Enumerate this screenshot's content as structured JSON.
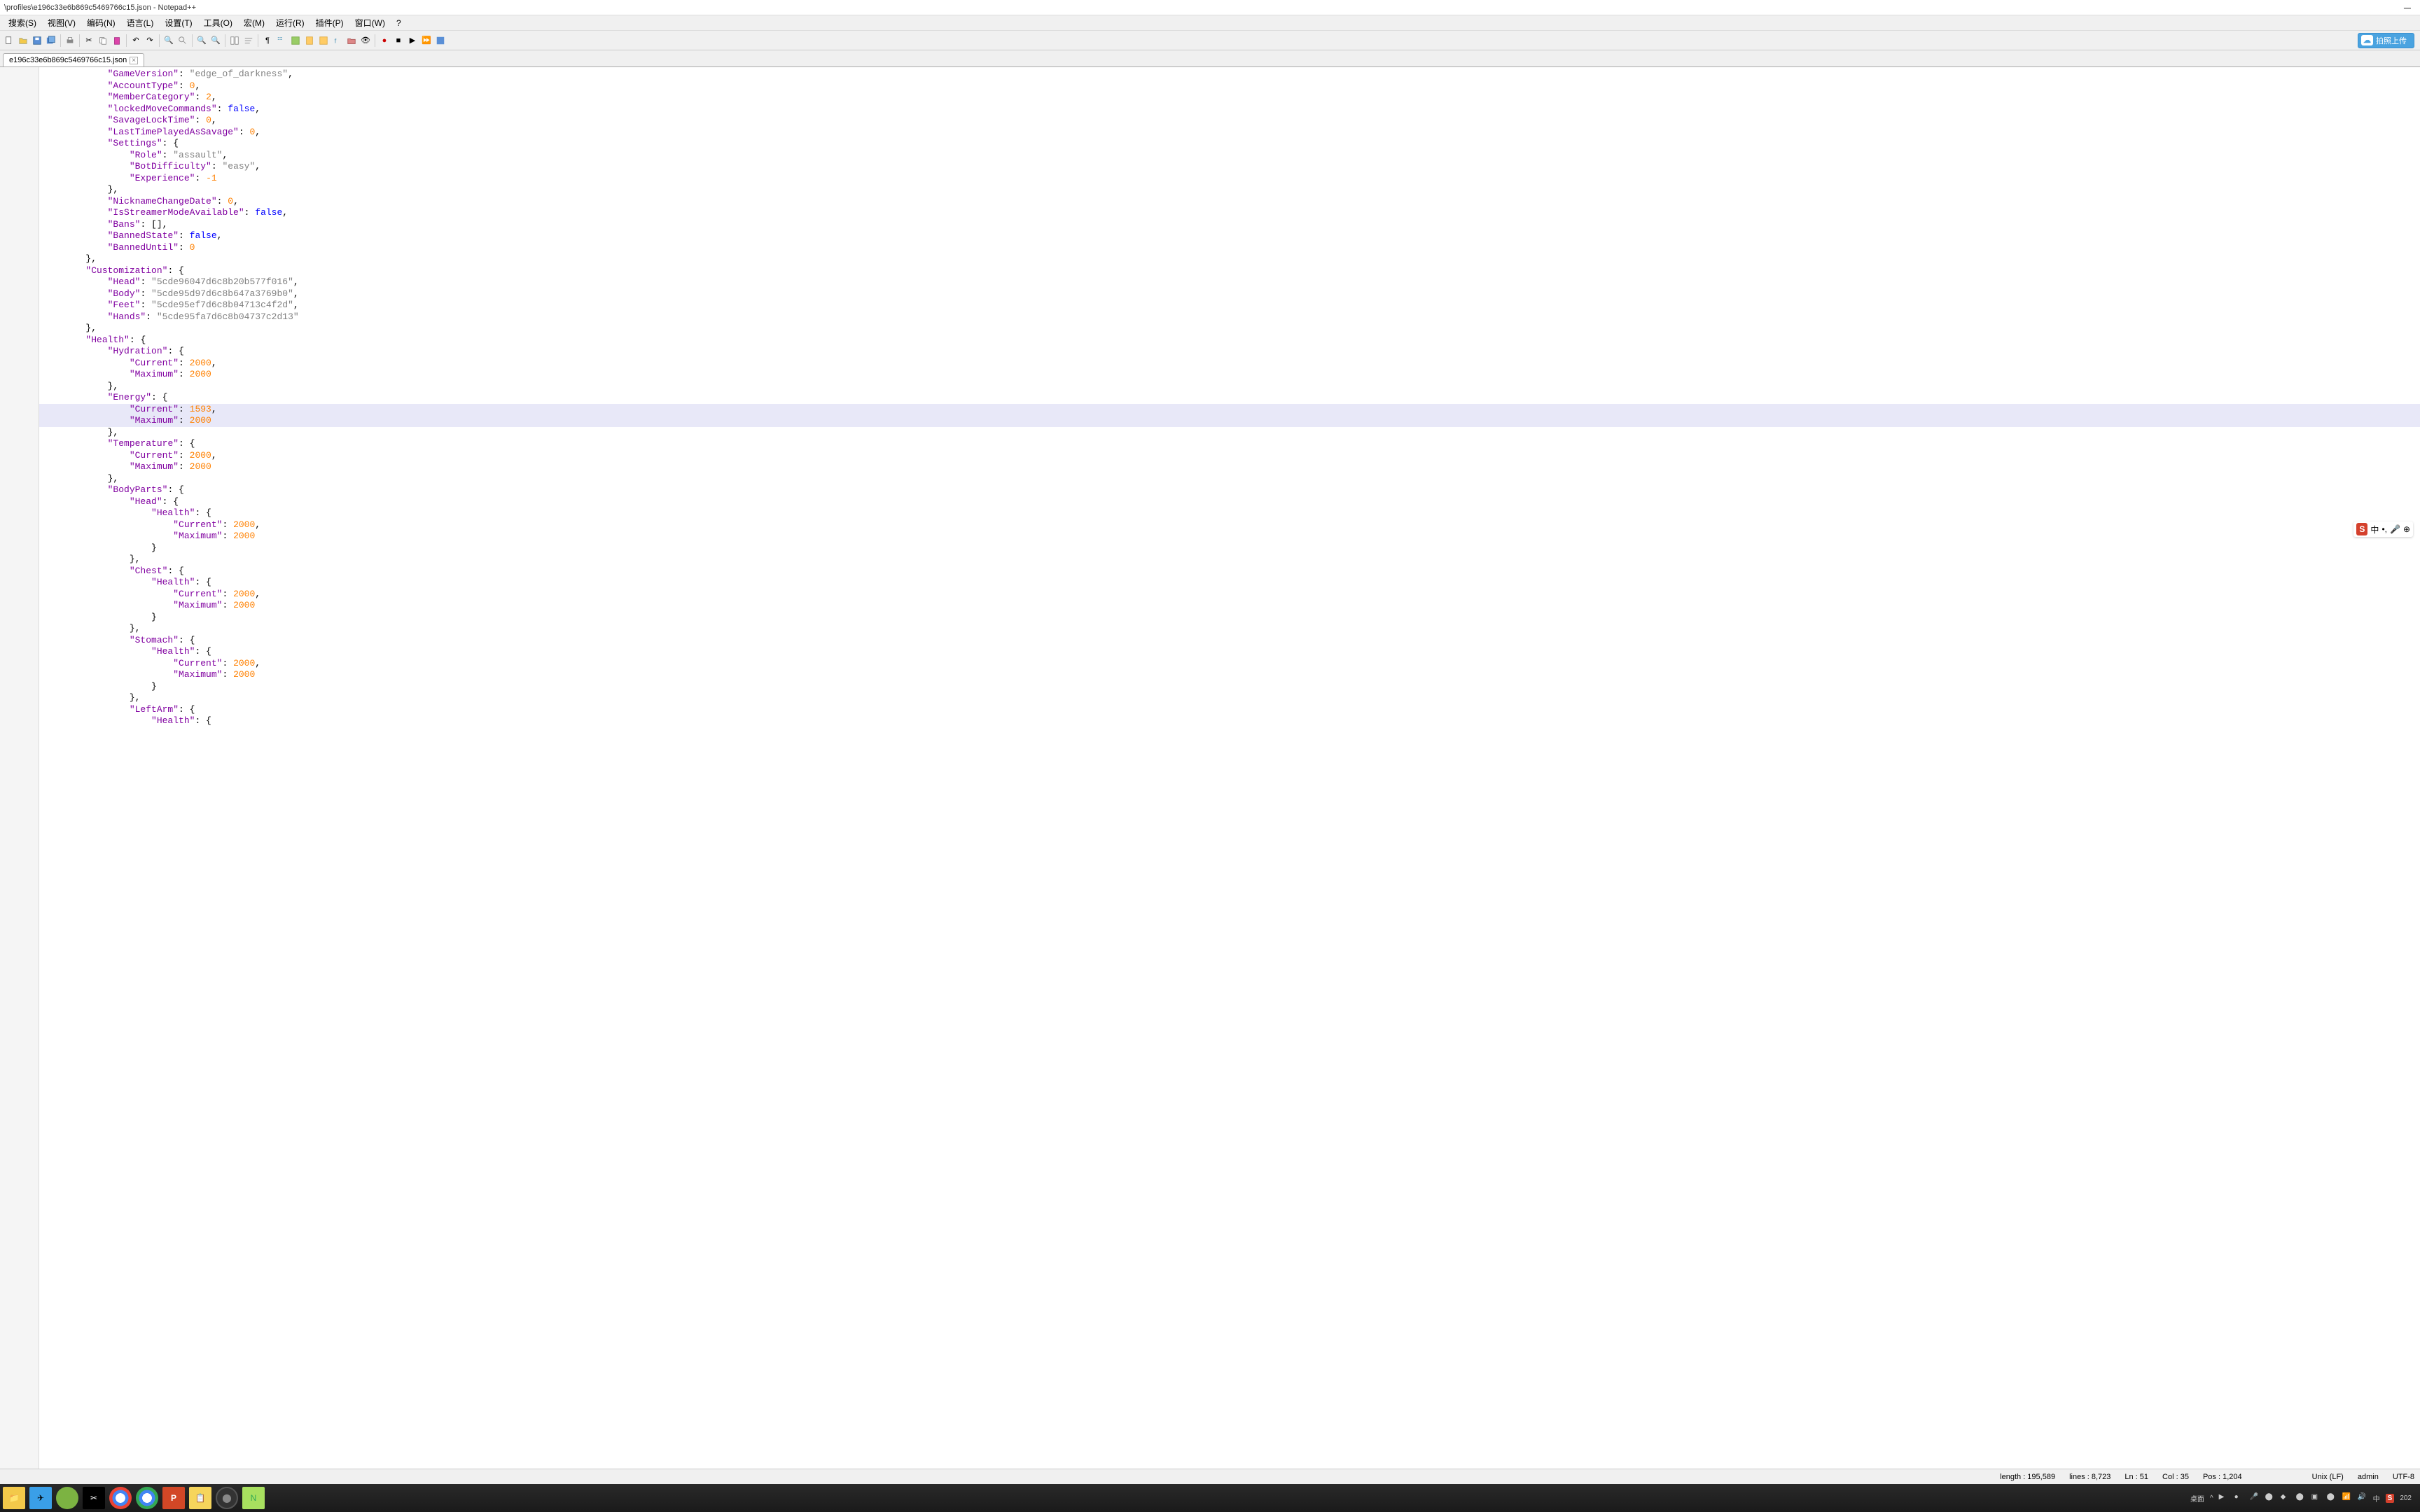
{
  "window": {
    "title": "\\profiles\\e196c33e6b869c5469766c15.json - Notepad++"
  },
  "menu": {
    "search": "搜索(S)",
    "view": "视图(V)",
    "encoding": "编码(N)",
    "language": "语言(L)",
    "settings": "设置(T)",
    "tools": "工具(O)",
    "macro": "宏(M)",
    "run": "运行(R)",
    "plugins": "插件(P)",
    "window": "窗口(W)",
    "help": "?"
  },
  "upload_button": "拍照上传",
  "tab": {
    "name": "e196c33e6b869c5469766c15.json"
  },
  "code": {
    "lines": [
      {
        "indent": 3,
        "content": [
          {
            "t": "key",
            "v": "\"GameVersion\""
          },
          {
            "t": "punc",
            "v": ": "
          },
          {
            "t": "str",
            "v": "\"edge_of_darkness\""
          },
          {
            "t": "punc",
            "v": ","
          }
        ]
      },
      {
        "indent": 3,
        "content": [
          {
            "t": "key",
            "v": "\"AccountType\""
          },
          {
            "t": "punc",
            "v": ": "
          },
          {
            "t": "num",
            "v": "0"
          },
          {
            "t": "punc",
            "v": ","
          }
        ]
      },
      {
        "indent": 3,
        "content": [
          {
            "t": "key",
            "v": "\"MemberCategory\""
          },
          {
            "t": "punc",
            "v": ": "
          },
          {
            "t": "num",
            "v": "2"
          },
          {
            "t": "punc",
            "v": ","
          }
        ]
      },
      {
        "indent": 3,
        "content": [
          {
            "t": "key",
            "v": "\"lockedMoveCommands\""
          },
          {
            "t": "punc",
            "v": ": "
          },
          {
            "t": "bool",
            "v": "false"
          },
          {
            "t": "punc",
            "v": ","
          }
        ]
      },
      {
        "indent": 3,
        "content": [
          {
            "t": "key",
            "v": "\"SavageLockTime\""
          },
          {
            "t": "punc",
            "v": ": "
          },
          {
            "t": "num",
            "v": "0"
          },
          {
            "t": "punc",
            "v": ","
          }
        ]
      },
      {
        "indent": 3,
        "content": [
          {
            "t": "key",
            "v": "\"LastTimePlayedAsSavage\""
          },
          {
            "t": "punc",
            "v": ": "
          },
          {
            "t": "num",
            "v": "0"
          },
          {
            "t": "punc",
            "v": ","
          }
        ]
      },
      {
        "indent": 3,
        "content": [
          {
            "t": "key",
            "v": "\"Settings\""
          },
          {
            "t": "punc",
            "v": ": {"
          }
        ]
      },
      {
        "indent": 4,
        "content": [
          {
            "t": "key",
            "v": "\"Role\""
          },
          {
            "t": "punc",
            "v": ": "
          },
          {
            "t": "str",
            "v": "\"assault\""
          },
          {
            "t": "punc",
            "v": ","
          }
        ]
      },
      {
        "indent": 4,
        "content": [
          {
            "t": "key",
            "v": "\"BotDifficulty\""
          },
          {
            "t": "punc",
            "v": ": "
          },
          {
            "t": "str",
            "v": "\"easy\""
          },
          {
            "t": "punc",
            "v": ","
          }
        ]
      },
      {
        "indent": 4,
        "content": [
          {
            "t": "key",
            "v": "\"Experience\""
          },
          {
            "t": "punc",
            "v": ": "
          },
          {
            "t": "num",
            "v": "-1"
          }
        ]
      },
      {
        "indent": 3,
        "content": [
          {
            "t": "punc",
            "v": "},"
          }
        ]
      },
      {
        "indent": 3,
        "content": [
          {
            "t": "key",
            "v": "\"NicknameChangeDate\""
          },
          {
            "t": "punc",
            "v": ": "
          },
          {
            "t": "num",
            "v": "0"
          },
          {
            "t": "punc",
            "v": ","
          }
        ]
      },
      {
        "indent": 3,
        "content": [
          {
            "t": "key",
            "v": "\"IsStreamerModeAvailable\""
          },
          {
            "t": "punc",
            "v": ": "
          },
          {
            "t": "bool",
            "v": "false"
          },
          {
            "t": "punc",
            "v": ","
          }
        ]
      },
      {
        "indent": 3,
        "content": [
          {
            "t": "key",
            "v": "\"Bans\""
          },
          {
            "t": "punc",
            "v": ": [],"
          }
        ]
      },
      {
        "indent": 3,
        "content": [
          {
            "t": "key",
            "v": "\"BannedState\""
          },
          {
            "t": "punc",
            "v": ": "
          },
          {
            "t": "bool",
            "v": "false"
          },
          {
            "t": "punc",
            "v": ","
          }
        ]
      },
      {
        "indent": 3,
        "content": [
          {
            "t": "key",
            "v": "\"BannedUntil\""
          },
          {
            "t": "punc",
            "v": ": "
          },
          {
            "t": "num",
            "v": "0"
          }
        ]
      },
      {
        "indent": 2,
        "content": [
          {
            "t": "punc",
            "v": "},"
          }
        ]
      },
      {
        "indent": 2,
        "content": [
          {
            "t": "key",
            "v": "\"Customization\""
          },
          {
            "t": "punc",
            "v": ": {"
          }
        ]
      },
      {
        "indent": 3,
        "content": [
          {
            "t": "key",
            "v": "\"Head\""
          },
          {
            "t": "punc",
            "v": ": "
          },
          {
            "t": "str",
            "v": "\"5cde96047d6c8b20b577f016\""
          },
          {
            "t": "punc",
            "v": ","
          }
        ]
      },
      {
        "indent": 3,
        "content": [
          {
            "t": "key",
            "v": "\"Body\""
          },
          {
            "t": "punc",
            "v": ": "
          },
          {
            "t": "str",
            "v": "\"5cde95d97d6c8b647a3769b0\""
          },
          {
            "t": "punc",
            "v": ","
          }
        ]
      },
      {
        "indent": 3,
        "content": [
          {
            "t": "key",
            "v": "\"Feet\""
          },
          {
            "t": "punc",
            "v": ": "
          },
          {
            "t": "str",
            "v": "\"5cde95ef7d6c8b04713c4f2d\""
          },
          {
            "t": "punc",
            "v": ","
          }
        ]
      },
      {
        "indent": 3,
        "content": [
          {
            "t": "key",
            "v": "\"Hands\""
          },
          {
            "t": "punc",
            "v": ": "
          },
          {
            "t": "str",
            "v": "\"5cde95fa7d6c8b04737c2d13\""
          }
        ]
      },
      {
        "indent": 2,
        "content": [
          {
            "t": "punc",
            "v": "},"
          }
        ]
      },
      {
        "indent": 2,
        "content": [
          {
            "t": "key",
            "v": "\"Health\""
          },
          {
            "t": "punc",
            "v": ": {"
          }
        ]
      },
      {
        "indent": 3,
        "content": [
          {
            "t": "key",
            "v": "\"Hydration\""
          },
          {
            "t": "punc",
            "v": ": {"
          }
        ]
      },
      {
        "indent": 4,
        "content": [
          {
            "t": "key",
            "v": "\"Current\""
          },
          {
            "t": "punc",
            "v": ": "
          },
          {
            "t": "num",
            "v": "2000"
          },
          {
            "t": "punc",
            "v": ","
          }
        ]
      },
      {
        "indent": 4,
        "content": [
          {
            "t": "key",
            "v": "\"Maximum\""
          },
          {
            "t": "punc",
            "v": ": "
          },
          {
            "t": "num",
            "v": "2000"
          }
        ]
      },
      {
        "indent": 3,
        "content": [
          {
            "t": "punc",
            "v": "},"
          }
        ]
      },
      {
        "indent": 3,
        "content": [
          {
            "t": "key",
            "v": "\"Energy\""
          },
          {
            "t": "punc",
            "v": ": {"
          }
        ]
      },
      {
        "indent": 4,
        "hl": true,
        "content": [
          {
            "t": "key",
            "v": "\"Current\""
          },
          {
            "t": "punc",
            "v": ": "
          },
          {
            "t": "num",
            "v": "1593"
          },
          {
            "t": "punc",
            "v": ","
          }
        ]
      },
      {
        "indent": 4,
        "hl": true,
        "content": [
          {
            "t": "key",
            "v": "\"Maximum\""
          },
          {
            "t": "punc",
            "v": ": "
          },
          {
            "t": "num",
            "v": "2000"
          }
        ]
      },
      {
        "indent": 3,
        "content": [
          {
            "t": "punc",
            "v": "},"
          }
        ]
      },
      {
        "indent": 3,
        "content": [
          {
            "t": "key",
            "v": "\"Temperature\""
          },
          {
            "t": "punc",
            "v": ": {"
          }
        ]
      },
      {
        "indent": 4,
        "content": [
          {
            "t": "key",
            "v": "\"Current\""
          },
          {
            "t": "punc",
            "v": ": "
          },
          {
            "t": "num",
            "v": "2000"
          },
          {
            "t": "punc",
            "v": ","
          }
        ]
      },
      {
        "indent": 4,
        "content": [
          {
            "t": "key",
            "v": "\"Maximum\""
          },
          {
            "t": "punc",
            "v": ": "
          },
          {
            "t": "num",
            "v": "2000"
          }
        ]
      },
      {
        "indent": 3,
        "content": [
          {
            "t": "punc",
            "v": "},"
          }
        ]
      },
      {
        "indent": 3,
        "content": [
          {
            "t": "key",
            "v": "\"BodyParts\""
          },
          {
            "t": "punc",
            "v": ": {"
          }
        ]
      },
      {
        "indent": 4,
        "content": [
          {
            "t": "key",
            "v": "\"Head\""
          },
          {
            "t": "punc",
            "v": ": {"
          }
        ]
      },
      {
        "indent": 5,
        "content": [
          {
            "t": "key",
            "v": "\"Health\""
          },
          {
            "t": "punc",
            "v": ": {"
          }
        ]
      },
      {
        "indent": 6,
        "content": [
          {
            "t": "key",
            "v": "\"Current\""
          },
          {
            "t": "punc",
            "v": ": "
          },
          {
            "t": "num",
            "v": "2000"
          },
          {
            "t": "punc",
            "v": ","
          }
        ]
      },
      {
        "indent": 6,
        "content": [
          {
            "t": "key",
            "v": "\"Maximum\""
          },
          {
            "t": "punc",
            "v": ": "
          },
          {
            "t": "num",
            "v": "2000"
          }
        ]
      },
      {
        "indent": 5,
        "content": [
          {
            "t": "punc",
            "v": "}"
          }
        ]
      },
      {
        "indent": 4,
        "content": [
          {
            "t": "punc",
            "v": "},"
          }
        ]
      },
      {
        "indent": 4,
        "content": [
          {
            "t": "key",
            "v": "\"Chest\""
          },
          {
            "t": "punc",
            "v": ": {"
          }
        ]
      },
      {
        "indent": 5,
        "content": [
          {
            "t": "key",
            "v": "\"Health\""
          },
          {
            "t": "punc",
            "v": ": {"
          }
        ]
      },
      {
        "indent": 6,
        "content": [
          {
            "t": "key",
            "v": "\"Current\""
          },
          {
            "t": "punc",
            "v": ": "
          },
          {
            "t": "num",
            "v": "2000"
          },
          {
            "t": "punc",
            "v": ","
          }
        ]
      },
      {
        "indent": 6,
        "content": [
          {
            "t": "key",
            "v": "\"Maximum\""
          },
          {
            "t": "punc",
            "v": ": "
          },
          {
            "t": "num",
            "v": "2000"
          }
        ]
      },
      {
        "indent": 5,
        "content": [
          {
            "t": "punc",
            "v": "}"
          }
        ]
      },
      {
        "indent": 4,
        "content": [
          {
            "t": "punc",
            "v": "},"
          }
        ]
      },
      {
        "indent": 4,
        "content": [
          {
            "t": "key",
            "v": "\"Stomach\""
          },
          {
            "t": "punc",
            "v": ": {"
          }
        ]
      },
      {
        "indent": 5,
        "content": [
          {
            "t": "key",
            "v": "\"Health\""
          },
          {
            "t": "punc",
            "v": ": {"
          }
        ]
      },
      {
        "indent": 6,
        "content": [
          {
            "t": "key",
            "v": "\"Current\""
          },
          {
            "t": "punc",
            "v": ": "
          },
          {
            "t": "num",
            "v": "2000"
          },
          {
            "t": "punc",
            "v": ","
          }
        ]
      },
      {
        "indent": 6,
        "content": [
          {
            "t": "key",
            "v": "\"Maximum\""
          },
          {
            "t": "punc",
            "v": ": "
          },
          {
            "t": "num",
            "v": "2000"
          }
        ]
      },
      {
        "indent": 5,
        "content": [
          {
            "t": "punc",
            "v": "}"
          }
        ]
      },
      {
        "indent": 4,
        "content": [
          {
            "t": "punc",
            "v": "},"
          }
        ]
      },
      {
        "indent": 4,
        "content": [
          {
            "t": "key",
            "v": "\"LeftArm\""
          },
          {
            "t": "punc",
            "v": ": {"
          }
        ]
      },
      {
        "indent": 5,
        "content": [
          {
            "t": "key",
            "v": "\"Health\""
          },
          {
            "t": "punc",
            "v": ": {"
          }
        ]
      }
    ]
  },
  "status": {
    "length": "length : 195,589",
    "lines": "lines : 8,723",
    "ln": "Ln : 51",
    "col": "Col : 35",
    "pos": "Pos : 1,204",
    "eol": "Unix (LF)",
    "user": "admin",
    "encoding": "UTF-8"
  },
  "ime": {
    "logo": "S",
    "lang": "中",
    "punct": "•,",
    "mic": "🎤",
    "more": "⊕"
  },
  "tray": {
    "desktop": "桌面",
    "lang": "中",
    "clock": "202"
  }
}
